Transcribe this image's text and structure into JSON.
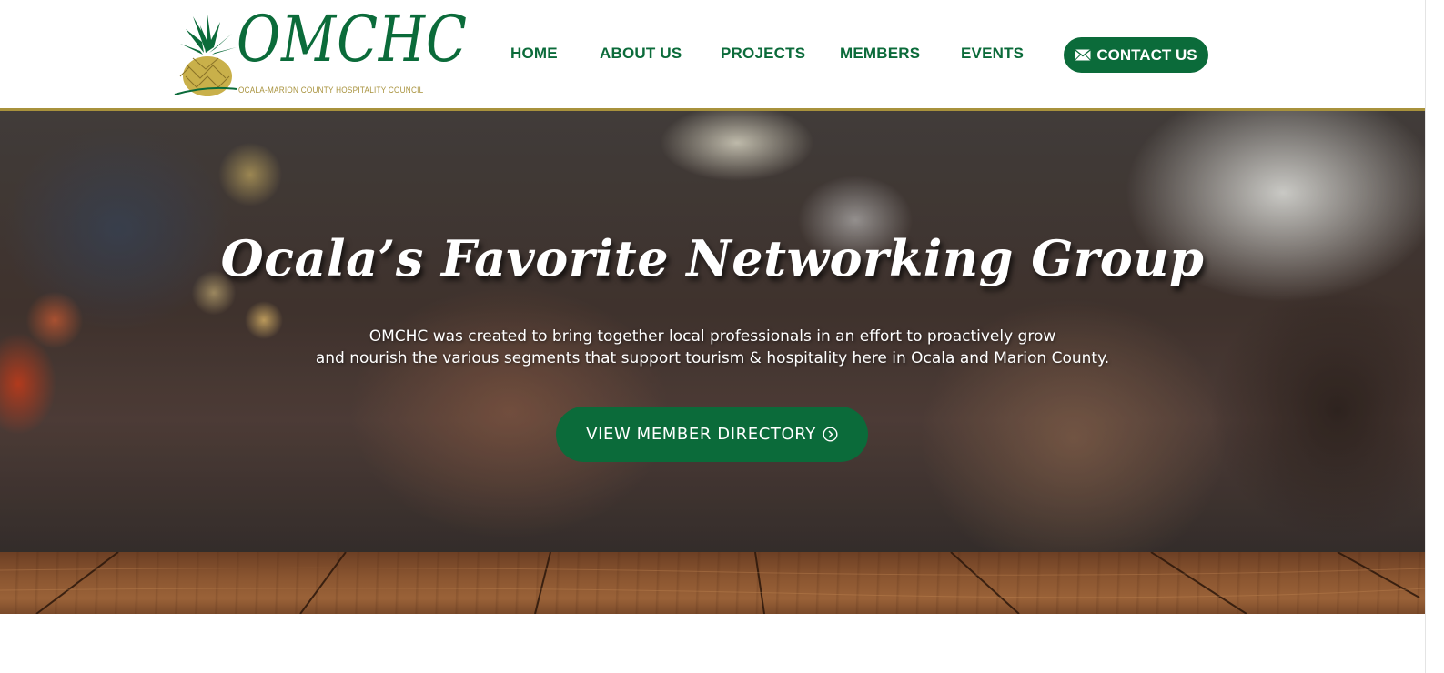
{
  "brand": {
    "logo_text": "OMCHC",
    "logo_subtitle": "OCALA-MARION COUNTY HOSPITALITY COUNCIL",
    "primary_color": "#0b6b3a",
    "accent_color": "#a8923c"
  },
  "nav": {
    "items": [
      {
        "label": "HOME"
      },
      {
        "label": "ABOUT US"
      },
      {
        "label": "PROJECTS"
      },
      {
        "label": "MEMBERS"
      },
      {
        "label": "EVENTS"
      }
    ],
    "contact_label": "CONTACT US",
    "contact_icon": "envelope-icon"
  },
  "hero": {
    "title": "Ocala’s Favorite Networking Group",
    "text_line_1": "OMCHC was created to bring together local professionals in an effort to proactively grow",
    "text_line_2": "and nourish the various segments that support tourism & hospitality here in Ocala and Marion County.",
    "button_label": "VIEW MEMBER DIRECTORY",
    "button_icon": "circle-chevron-right-icon"
  }
}
